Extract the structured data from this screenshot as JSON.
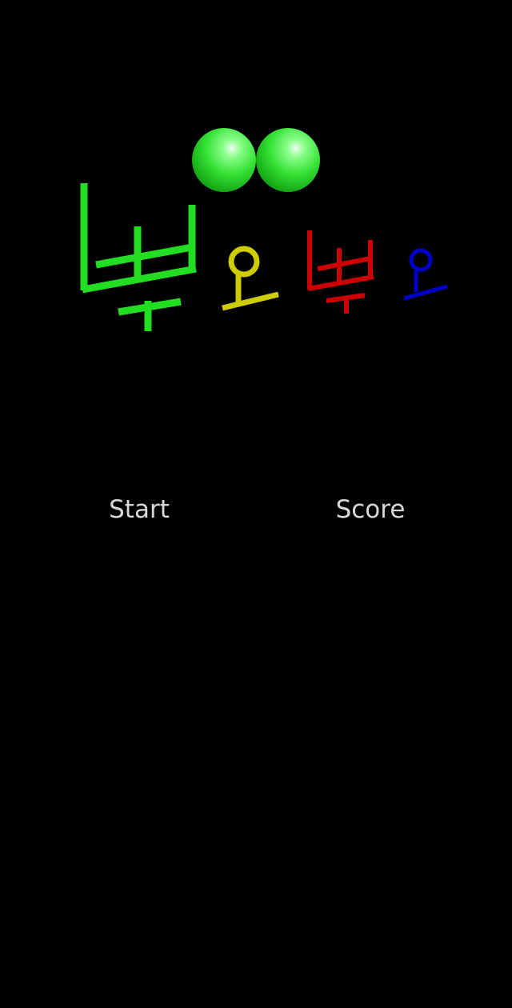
{
  "title": {
    "text": "뿌요뿌요",
    "colors": {
      "first_syllable": "#22dd22",
      "second_syllable": "#cccc00",
      "third_syllable": "#cc0000",
      "fourth_syllable": "#0000cc",
      "ball": "#33ee33"
    }
  },
  "menu": {
    "start_label": "Start",
    "score_label": "Score"
  },
  "colors": {
    "background": "#000000",
    "menu_text": "#d8d8d8"
  }
}
